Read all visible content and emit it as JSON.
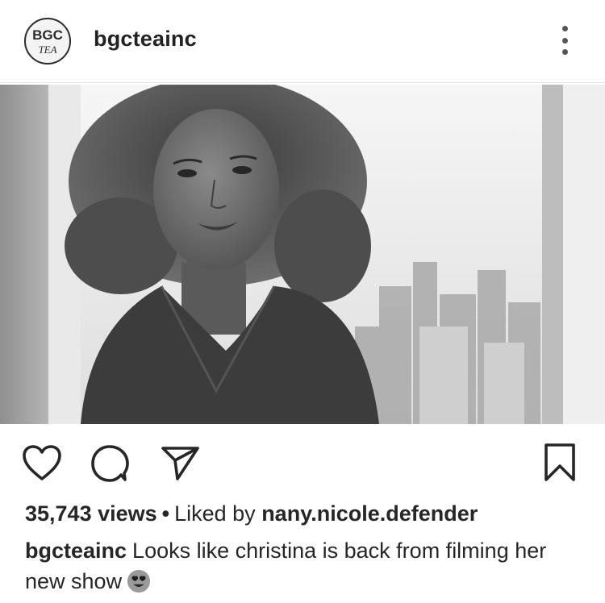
{
  "header": {
    "avatar_text_top": "BGC",
    "avatar_text_bottom": "TEA",
    "username": "bgcteainc",
    "more_icon": "vertical-ellipsis-icon"
  },
  "media": {
    "type": "video-still",
    "tone": "black-and-white"
  },
  "actions": {
    "like_icon": "heart-outline-icon",
    "comment_icon": "comment-bubble-icon",
    "share_icon": "send-paper-plane-icon",
    "save_icon": "bookmark-outline-icon"
  },
  "stats": {
    "views": "35,743 views",
    "separator": "•",
    "liked_by_prefix": "Liked by",
    "liked_by_user": "nany.nicole.defender"
  },
  "caption": {
    "username": "bgcteainc",
    "text": "Looks like christina is back from filming her new show",
    "emoji": "heart-eyes-emoji"
  },
  "colors": {
    "text": "#262626",
    "divider": "#e6e6e6",
    "icon": "#262626"
  }
}
